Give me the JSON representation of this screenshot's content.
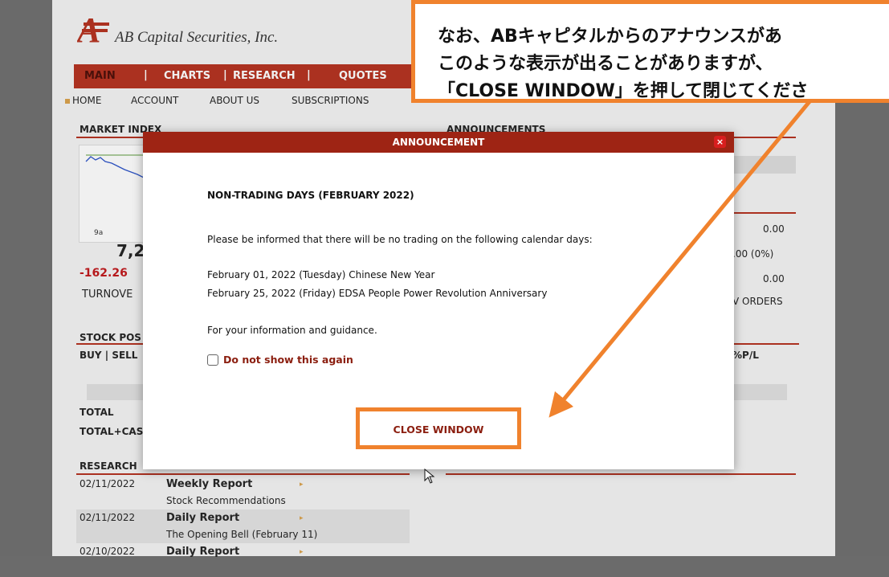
{
  "brand": {
    "company": "AB Capital Securities, Inc.",
    "accent": "#b5301e",
    "highlight": "#f0822d"
  },
  "nav": {
    "main": "MAIN",
    "charts": "CHARTS",
    "research": "RESEARCH",
    "quotes": "QUOTES",
    "sep": "|"
  },
  "subnav": {
    "home": "HOME",
    "account": "ACCOUNT",
    "about": "ABOUT US",
    "subscriptions": "SUBSCRIPTIONS"
  },
  "market": {
    "heading": "MARKET INDEX",
    "chart_time": "9a",
    "index_value": "7,2",
    "change": "-162.26",
    "turnover": "TURNOVE"
  },
  "announcements": {
    "heading": "ANNOUNCEMENTS",
    "vals": [
      "0.00",
      ".00 (0%)",
      "0.00"
    ],
    "orders": "V ORDERS"
  },
  "stock": {
    "heading": "STOCK POS",
    "buysell": "BUY | SELL",
    "pl": "%P/L",
    "total": "TOTAL",
    "total_cash": "TOTAL+CAS"
  },
  "research": {
    "heading": "RESEARCH",
    "news_heading": "",
    "rows": [
      {
        "date": "02/11/2022",
        "title": "Weekly Report",
        "sub": "Stock Recommendations"
      },
      {
        "date": "02/11/2022",
        "title": "Daily Report",
        "sub": "The Opening Bell (February 11)"
      },
      {
        "date": "02/10/2022",
        "title": "Daily Report",
        "sub": ""
      }
    ]
  },
  "modal": {
    "title": "ANNOUNCEMENT",
    "close_icon": "×",
    "heading": "NON-TRADING DAYS (FEBRUARY 2022)",
    "intro": "Please be informed that there will be no trading on the following calendar days:",
    "day1": "February 01, 2022 (Tuesday) Chinese New Year",
    "day2": "February 25, 2022 (Friday) EDSA People Power Revolution Anniversary",
    "guidance": "For your information and guidance.",
    "dont_show": "Do not show this again",
    "close_button": "CLOSE WINDOW"
  },
  "callout": {
    "line1": "なお、ABキャピタルからのアナウンスがあ",
    "line2": "このような表示が出ることがありますが、",
    "line3": "「CLOSE WINDOW」を押して閉じてくださ"
  }
}
